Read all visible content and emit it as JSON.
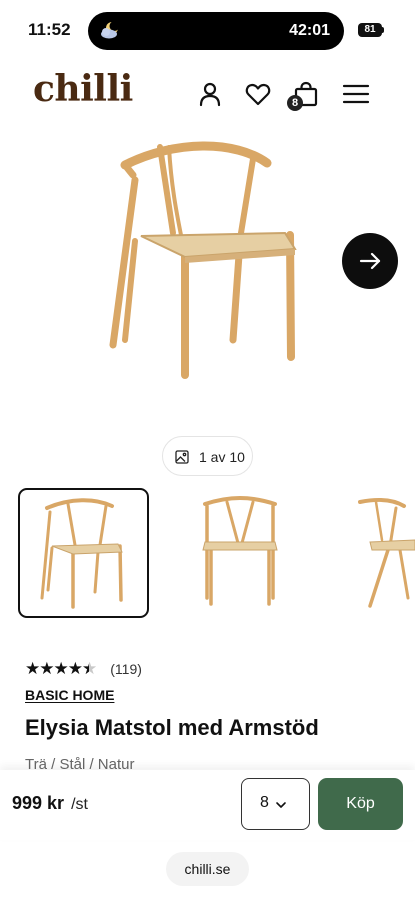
{
  "status": {
    "time": "11:52",
    "timer": "42:01",
    "battery": "81",
    "weather_icon": "cloud-moon-icon"
  },
  "header": {
    "logo": "chilli",
    "cart_count": "8",
    "icons": [
      "account-icon",
      "heart-icon",
      "bag-icon",
      "menu-icon"
    ]
  },
  "gallery": {
    "counter": "1 av 10",
    "counter_icon": "image-icon",
    "next_icon": "arrow-right-icon",
    "thumbnails": [
      "chair-front-angle",
      "chair-front",
      "chair-side"
    ],
    "selected_thumbnail": 0
  },
  "product": {
    "rating": 4.5,
    "review_count": "(119)",
    "brand": "BASIC HOME",
    "title": "Elysia Matstol med Armstöd",
    "variant": "Trä / Stål / Natur",
    "price": "999 kr",
    "unit": "/st",
    "quantity": "8",
    "buy_label": "Köp"
  },
  "browser": {
    "url": "chilli.se"
  },
  "colors": {
    "brand": "#4a2a12",
    "buy_button": "#406a4b",
    "wood": "#d9a766",
    "seat": "#e6cfa3"
  }
}
